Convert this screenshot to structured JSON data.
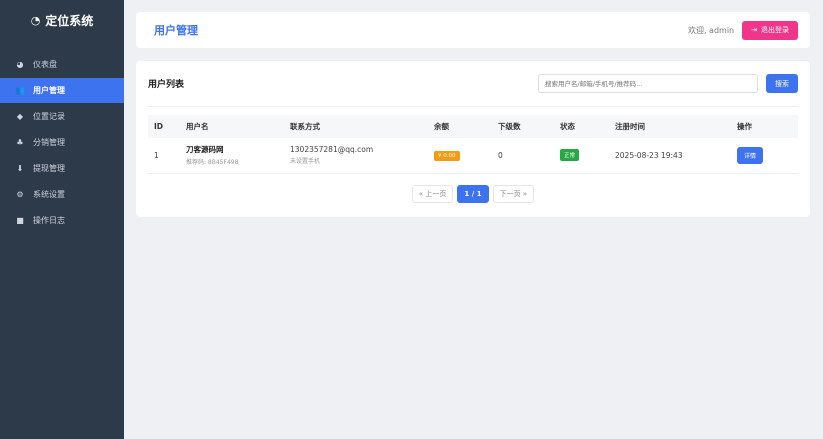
{
  "brand": {
    "title": "定位系统",
    "icon": "location-icon"
  },
  "sidebar": {
    "items": [
      {
        "label": "仪表盘",
        "icon": "dashboard-icon",
        "glyph": "◕",
        "active": false
      },
      {
        "label": "用户管理",
        "icon": "users-icon",
        "glyph": "👥",
        "active": true
      },
      {
        "label": "位置记录",
        "icon": "location-record-icon",
        "glyph": "◆",
        "active": false
      },
      {
        "label": "分销管理",
        "icon": "sitemap-icon",
        "glyph": "♣",
        "active": false
      },
      {
        "label": "提现管理",
        "icon": "withdraw-icon",
        "glyph": "⬇",
        "active": false
      },
      {
        "label": "系统设置",
        "icon": "settings-icon",
        "glyph": "⚙",
        "active": false
      },
      {
        "label": "操作日志",
        "icon": "log-icon",
        "glyph": "■",
        "active": false
      }
    ]
  },
  "header": {
    "title": "用户管理",
    "welcome": "欢迎, admin",
    "logout_label": "退出登录",
    "logout_icon": "logout-icon"
  },
  "list": {
    "title": "用户列表",
    "search_placeholder": "搜索用户名/邮箱/手机号/推荐码...",
    "search_label": "搜索",
    "columns": [
      "ID",
      "用户名",
      "联系方式",
      "余额",
      "下级数",
      "状态",
      "注册时间",
      "操作"
    ],
    "rows": [
      {
        "id": "1",
        "username": "刀客源码网",
        "referral": "推荐码: 8B45F498",
        "email": "1302357281@qq.com",
        "phone": "未设置手机",
        "balance": "¥ 0.00",
        "subordinates": "0",
        "status": "正常",
        "registered": "2025-08-23 19:43",
        "action": "详情"
      }
    ]
  },
  "pagination": {
    "prev": "« 上一页",
    "current": "1 / 1",
    "next": "下一页 »"
  },
  "colors": {
    "sidebar": "#2d3a4a",
    "accent": "#3e73f0",
    "logout": "#f0358a",
    "balance_badge": "#f39c12",
    "status_badge": "#28a745"
  }
}
